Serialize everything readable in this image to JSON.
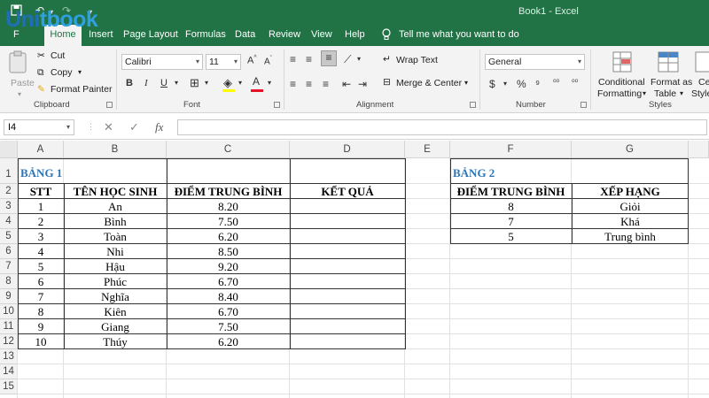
{
  "window": {
    "title": "Book1  -  Excel"
  },
  "logo": {
    "part1": "Uni",
    "part2": "tbook"
  },
  "tabs": [
    "Home",
    "Insert",
    "Page Layout",
    "Formulas",
    "Data",
    "Review",
    "View",
    "Help"
  ],
  "tell_me": "Tell me what you want to do",
  "ribbon": {
    "clipboard": {
      "paste": "Paste",
      "cut": "Cut",
      "copy": "Copy",
      "format_painter": "Format Painter",
      "label": "Clipboard"
    },
    "font": {
      "name": "Calibri",
      "size": "11",
      "bold": "B",
      "italic": "I",
      "underline": "U",
      "label": "Font"
    },
    "alignment": {
      "wrap": "Wrap Text",
      "merge": "Merge & Center",
      "label": "Alignment"
    },
    "number": {
      "format": "General",
      "label": "Number"
    },
    "styles": {
      "conditional_1": "Conditional",
      "conditional_2": "Formatting",
      "table_1": "Format as",
      "table_2": "Table",
      "cell_1": "Cel",
      "cell_2": "Style",
      "label": "Styles"
    }
  },
  "formula_bar": {
    "name_box": "I4",
    "cancel": "✕",
    "enter": "✓",
    "fx": "fx"
  },
  "columns": [
    "A",
    "B",
    "C",
    "D",
    "E",
    "F",
    "G"
  ],
  "rows": [
    "1",
    "2",
    "3",
    "4",
    "5",
    "6",
    "7",
    "8",
    "9",
    "10",
    "11",
    "12",
    "13",
    "14",
    "15"
  ],
  "table1": {
    "title": "BẢNG 1",
    "headers": [
      "STT",
      "TÊN HỌC SINH",
      "ĐIỂM TRUNG BÌNH",
      "KẾT QUẢ"
    ],
    "rows": [
      [
        "1",
        "An",
        "8.20"
      ],
      [
        "2",
        "Bình",
        "7.50"
      ],
      [
        "3",
        "Toàn",
        "6.20"
      ],
      [
        "4",
        "Nhi",
        "8.50"
      ],
      [
        "5",
        "Hậu",
        "9.20"
      ],
      [
        "6",
        "Phúc",
        "6.70"
      ],
      [
        "7",
        "Nghĩa",
        "8.40"
      ],
      [
        "8",
        "Kiên",
        "6.70"
      ],
      [
        "9",
        "Giang",
        "7.50"
      ],
      [
        "10",
        "Thúy",
        "6.20"
      ]
    ]
  },
  "table2": {
    "title": "BẢNG 2",
    "headers": [
      "ĐIỂM TRUNG BÌNH",
      "XẾP HẠNG"
    ],
    "rows": [
      [
        "8",
        "Giỏi"
      ],
      [
        "7",
        "Khá"
      ],
      [
        "5",
        "Trung bình"
      ]
    ]
  },
  "colors": {
    "excel_green": "#217346",
    "title_blue": "#2e75b6",
    "font_red": "#e81123"
  }
}
